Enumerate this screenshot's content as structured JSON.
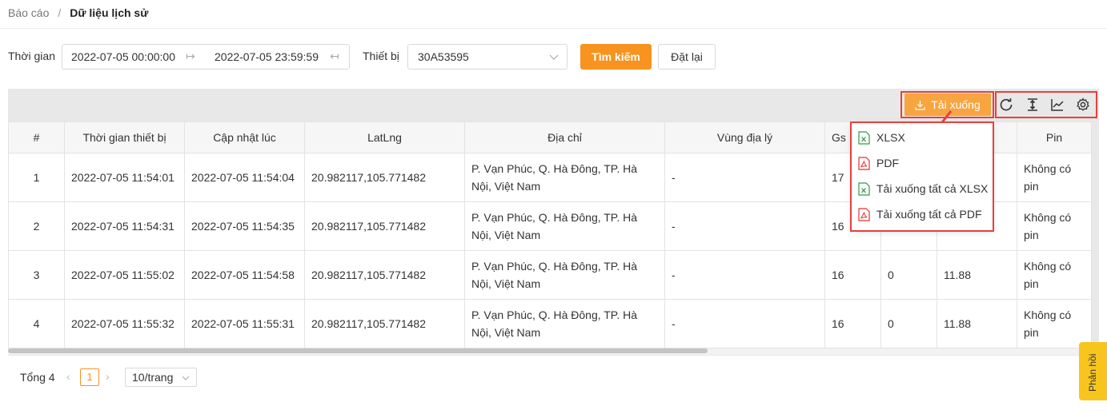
{
  "breadcrumb": {
    "parent": "Báo cáo",
    "separator": "/",
    "current": "Dữ liệu lịch sử"
  },
  "filters": {
    "time_label": "Thời gian",
    "date_start": "2022-07-05 00:00:00",
    "date_end": "2022-07-05 23:59:59",
    "device_label": "Thiết bị",
    "device_value": "30A53595",
    "search_label": "Tìm kiếm",
    "reset_label": "Đặt lại"
  },
  "toolbar": {
    "download_label": "Tải xuống"
  },
  "download_menu": {
    "items": [
      {
        "label": "XLSX",
        "type": "xlsx"
      },
      {
        "label": "PDF",
        "type": "pdf"
      },
      {
        "label": "Tải xuống tất cả XLSX",
        "type": "xlsx"
      },
      {
        "label": "Tải xuống tất cả PDF",
        "type": "pdf"
      }
    ]
  },
  "table": {
    "headers": [
      "#",
      "Thời gian thiết bị",
      "Cập nhật lúc",
      "LatLng",
      "Địa chỉ",
      "Vùng địa lý",
      "Gs",
      "",
      "ol)",
      "Pin"
    ],
    "rows": [
      [
        "1",
        "2022-07-05 11:54:01",
        "2022-07-05 11:54:04",
        "20.982117,105.771482",
        "P. Vạn Phúc, Q. Hà Đông, TP. Hà Nội, Việt Nam",
        "-",
        "17",
        "",
        "",
        "Không có pin"
      ],
      [
        "2",
        "2022-07-05 11:54:31",
        "2022-07-05 11:54:35",
        "20.982117,105.771482",
        "P. Vạn Phúc, Q. Hà Đông, TP. Hà Nội, Việt Nam",
        "-",
        "16",
        "",
        "",
        "Không có pin"
      ],
      [
        "3",
        "2022-07-05 11:55:02",
        "2022-07-05 11:54:58",
        "20.982117,105.771482",
        "P. Vạn Phúc, Q. Hà Đông, TP. Hà Nội, Việt Nam",
        "-",
        "16",
        "0",
        "11.88",
        "Không có pin"
      ],
      [
        "4",
        "2022-07-05 11:55:32",
        "2022-07-05 11:55:31",
        "20.982117,105.771482",
        "P. Vạn Phúc, Q. Hà Đông, TP. Hà Nội, Việt Nam",
        "-",
        "16",
        "0",
        "11.88",
        "Không có pin"
      ]
    ]
  },
  "pagination": {
    "total": "Tổng 4",
    "current_page": "1",
    "page_size": "10/trang"
  },
  "feedback": {
    "label": "Phản hồi"
  },
  "colors": {
    "accent": "#f7931e",
    "highlight": "#e8403a"
  }
}
